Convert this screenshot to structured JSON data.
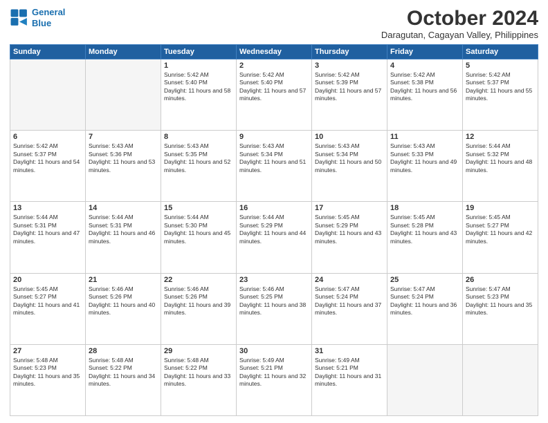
{
  "header": {
    "logo_line1": "General",
    "logo_line2": "Blue",
    "month": "October 2024",
    "location": "Daragutan, Cagayan Valley, Philippines"
  },
  "weekdays": [
    "Sunday",
    "Monday",
    "Tuesday",
    "Wednesday",
    "Thursday",
    "Friday",
    "Saturday"
  ],
  "weeks": [
    [
      {
        "empty": true
      },
      {
        "empty": true
      },
      {
        "day": 1,
        "sunrise": "5:42 AM",
        "sunset": "5:40 PM",
        "daylight": "11 hours and 58 minutes."
      },
      {
        "day": 2,
        "sunrise": "5:42 AM",
        "sunset": "5:40 PM",
        "daylight": "11 hours and 57 minutes."
      },
      {
        "day": 3,
        "sunrise": "5:42 AM",
        "sunset": "5:39 PM",
        "daylight": "11 hours and 57 minutes."
      },
      {
        "day": 4,
        "sunrise": "5:42 AM",
        "sunset": "5:38 PM",
        "daylight": "11 hours and 56 minutes."
      },
      {
        "day": 5,
        "sunrise": "5:42 AM",
        "sunset": "5:37 PM",
        "daylight": "11 hours and 55 minutes."
      }
    ],
    [
      {
        "day": 6,
        "sunrise": "5:42 AM",
        "sunset": "5:37 PM",
        "daylight": "11 hours and 54 minutes."
      },
      {
        "day": 7,
        "sunrise": "5:43 AM",
        "sunset": "5:36 PM",
        "daylight": "11 hours and 53 minutes."
      },
      {
        "day": 8,
        "sunrise": "5:43 AM",
        "sunset": "5:35 PM",
        "daylight": "11 hours and 52 minutes."
      },
      {
        "day": 9,
        "sunrise": "5:43 AM",
        "sunset": "5:34 PM",
        "daylight": "11 hours and 51 minutes."
      },
      {
        "day": 10,
        "sunrise": "5:43 AM",
        "sunset": "5:34 PM",
        "daylight": "11 hours and 50 minutes."
      },
      {
        "day": 11,
        "sunrise": "5:43 AM",
        "sunset": "5:33 PM",
        "daylight": "11 hours and 49 minutes."
      },
      {
        "day": 12,
        "sunrise": "5:44 AM",
        "sunset": "5:32 PM",
        "daylight": "11 hours and 48 minutes."
      }
    ],
    [
      {
        "day": 13,
        "sunrise": "5:44 AM",
        "sunset": "5:31 PM",
        "daylight": "11 hours and 47 minutes."
      },
      {
        "day": 14,
        "sunrise": "5:44 AM",
        "sunset": "5:31 PM",
        "daylight": "11 hours and 46 minutes."
      },
      {
        "day": 15,
        "sunrise": "5:44 AM",
        "sunset": "5:30 PM",
        "daylight": "11 hours and 45 minutes."
      },
      {
        "day": 16,
        "sunrise": "5:44 AM",
        "sunset": "5:29 PM",
        "daylight": "11 hours and 44 minutes."
      },
      {
        "day": 17,
        "sunrise": "5:45 AM",
        "sunset": "5:29 PM",
        "daylight": "11 hours and 43 minutes."
      },
      {
        "day": 18,
        "sunrise": "5:45 AM",
        "sunset": "5:28 PM",
        "daylight": "11 hours and 43 minutes."
      },
      {
        "day": 19,
        "sunrise": "5:45 AM",
        "sunset": "5:27 PM",
        "daylight": "11 hours and 42 minutes."
      }
    ],
    [
      {
        "day": 20,
        "sunrise": "5:45 AM",
        "sunset": "5:27 PM",
        "daylight": "11 hours and 41 minutes."
      },
      {
        "day": 21,
        "sunrise": "5:46 AM",
        "sunset": "5:26 PM",
        "daylight": "11 hours and 40 minutes."
      },
      {
        "day": 22,
        "sunrise": "5:46 AM",
        "sunset": "5:26 PM",
        "daylight": "11 hours and 39 minutes."
      },
      {
        "day": 23,
        "sunrise": "5:46 AM",
        "sunset": "5:25 PM",
        "daylight": "11 hours and 38 minutes."
      },
      {
        "day": 24,
        "sunrise": "5:47 AM",
        "sunset": "5:24 PM",
        "daylight": "11 hours and 37 minutes."
      },
      {
        "day": 25,
        "sunrise": "5:47 AM",
        "sunset": "5:24 PM",
        "daylight": "11 hours and 36 minutes."
      },
      {
        "day": 26,
        "sunrise": "5:47 AM",
        "sunset": "5:23 PM",
        "daylight": "11 hours and 35 minutes."
      }
    ],
    [
      {
        "day": 27,
        "sunrise": "5:48 AM",
        "sunset": "5:23 PM",
        "daylight": "11 hours and 35 minutes."
      },
      {
        "day": 28,
        "sunrise": "5:48 AM",
        "sunset": "5:22 PM",
        "daylight": "11 hours and 34 minutes."
      },
      {
        "day": 29,
        "sunrise": "5:48 AM",
        "sunset": "5:22 PM",
        "daylight": "11 hours and 33 minutes."
      },
      {
        "day": 30,
        "sunrise": "5:49 AM",
        "sunset": "5:21 PM",
        "daylight": "11 hours and 32 minutes."
      },
      {
        "day": 31,
        "sunrise": "5:49 AM",
        "sunset": "5:21 PM",
        "daylight": "11 hours and 31 minutes."
      },
      {
        "empty": true
      },
      {
        "empty": true
      }
    ]
  ]
}
